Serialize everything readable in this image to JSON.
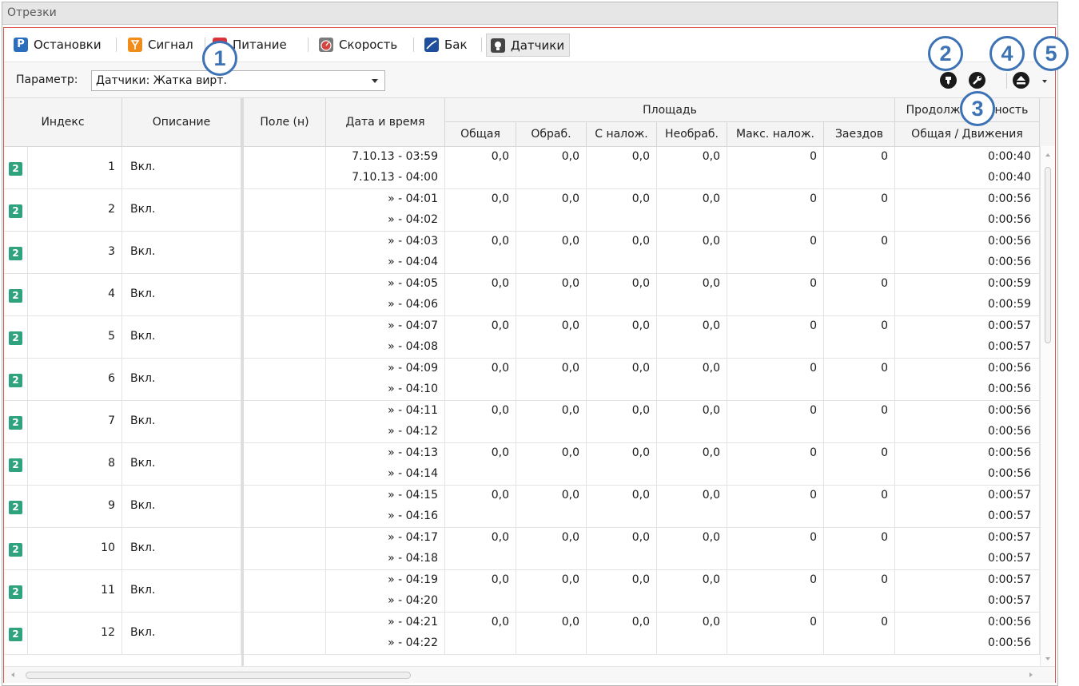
{
  "window": {
    "title": "Отрезки"
  },
  "tabs": [
    {
      "label": "Остановки",
      "icon": "parking-icon"
    },
    {
      "label": "Сигнал",
      "icon": "signal-icon"
    },
    {
      "label": "Питание",
      "icon": "power-icon"
    },
    {
      "label": "Скорость",
      "icon": "speedometer-icon"
    },
    {
      "label": "Бак",
      "icon": "fuel-tank-icon"
    },
    {
      "label": "Датчики",
      "icon": "sensor-icon",
      "active": true
    }
  ],
  "parameter": {
    "label": "Параметр:",
    "value": "Датчики: Жатка вирт."
  },
  "toolbar": {
    "icons": [
      "pin-icon",
      "wrench-icon",
      "eject-icon",
      "dropdown-arrow-icon"
    ]
  },
  "columns": {
    "index": "Индекс",
    "description": "Описание",
    "field": "Поле (н)",
    "datetime": "Дата и время",
    "area_group": "Площадь",
    "area_total": "Общая",
    "area_processed": "Обраб.",
    "area_overlap": "С налож.",
    "area_unprocessed": "Необраб.",
    "max_overlap": "Макс. налож.",
    "passes": "Заездов",
    "duration_group": "Продолжительность",
    "duration_sub": "Общая / Движения"
  },
  "rows": [
    {
      "icon": "2",
      "index": "1",
      "description": "Вкл.",
      "field": "",
      "start": "7.10.13 - 03:59",
      "end": "7.10.13 - 04:00",
      "total": "0,0",
      "processed": "0,0",
      "overlap": "0,0",
      "unprocessed": "0,0",
      "max_overlap": "0",
      "passes": "0",
      "duration_total": "0:00:40",
      "duration_moving": "0:00:40"
    },
    {
      "icon": "2",
      "index": "2",
      "description": "Вкл.",
      "field": "",
      "start": "» - 04:01",
      "end": "» - 04:02",
      "total": "0,0",
      "processed": "0,0",
      "overlap": "0,0",
      "unprocessed": "0,0",
      "max_overlap": "0",
      "passes": "0",
      "duration_total": "0:00:56",
      "duration_moving": "0:00:56"
    },
    {
      "icon": "2",
      "index": "3",
      "description": "Вкл.",
      "field": "",
      "start": "» - 04:03",
      "end": "» - 04:04",
      "total": "0,0",
      "processed": "0,0",
      "overlap": "0,0",
      "unprocessed": "0,0",
      "max_overlap": "0",
      "passes": "0",
      "duration_total": "0:00:56",
      "duration_moving": "0:00:56"
    },
    {
      "icon": "2",
      "index": "4",
      "description": "Вкл.",
      "field": "",
      "start": "» - 04:05",
      "end": "» - 04:06",
      "total": "0,0",
      "processed": "0,0",
      "overlap": "0,0",
      "unprocessed": "0,0",
      "max_overlap": "0",
      "passes": "0",
      "duration_total": "0:00:59",
      "duration_moving": "0:00:59"
    },
    {
      "icon": "2",
      "index": "5",
      "description": "Вкл.",
      "field": "",
      "start": "» - 04:07",
      "end": "» - 04:08",
      "total": "0,0",
      "processed": "0,0",
      "overlap": "0,0",
      "unprocessed": "0,0",
      "max_overlap": "0",
      "passes": "0",
      "duration_total": "0:00:57",
      "duration_moving": "0:00:57"
    },
    {
      "icon": "2",
      "index": "6",
      "description": "Вкл.",
      "field": "",
      "start": "» - 04:09",
      "end": "» - 04:10",
      "total": "0,0",
      "processed": "0,0",
      "overlap": "0,0",
      "unprocessed": "0,0",
      "max_overlap": "0",
      "passes": "0",
      "duration_total": "0:00:56",
      "duration_moving": "0:00:56"
    },
    {
      "icon": "2",
      "index": "7",
      "description": "Вкл.",
      "field": "",
      "start": "» - 04:11",
      "end": "» - 04:12",
      "total": "0,0",
      "processed": "0,0",
      "overlap": "0,0",
      "unprocessed": "0,0",
      "max_overlap": "0",
      "passes": "0",
      "duration_total": "0:00:56",
      "duration_moving": "0:00:56"
    },
    {
      "icon": "2",
      "index": "8",
      "description": "Вкл.",
      "field": "",
      "start": "» - 04:13",
      "end": "» - 04:14",
      "total": "0,0",
      "processed": "0,0",
      "overlap": "0,0",
      "unprocessed": "0,0",
      "max_overlap": "0",
      "passes": "0",
      "duration_total": "0:00:56",
      "duration_moving": "0:00:56"
    },
    {
      "icon": "2",
      "index": "9",
      "description": "Вкл.",
      "field": "",
      "start": "» - 04:15",
      "end": "» - 04:16",
      "total": "0,0",
      "processed": "0,0",
      "overlap": "0,0",
      "unprocessed": "0,0",
      "max_overlap": "0",
      "passes": "0",
      "duration_total": "0:00:57",
      "duration_moving": "0:00:57"
    },
    {
      "icon": "2",
      "index": "10",
      "description": "Вкл.",
      "field": "",
      "start": "» - 04:17",
      "end": "» - 04:18",
      "total": "0,0",
      "processed": "0,0",
      "overlap": "0,0",
      "unprocessed": "0,0",
      "max_overlap": "0",
      "passes": "0",
      "duration_total": "0:00:57",
      "duration_moving": "0:00:57"
    },
    {
      "icon": "2",
      "index": "11",
      "description": "Вкл.",
      "field": "",
      "start": "» - 04:19",
      "end": "» - 04:20",
      "total": "0,0",
      "processed": "0,0",
      "overlap": "0,0",
      "unprocessed": "0,0",
      "max_overlap": "0",
      "passes": "0",
      "duration_total": "0:00:57",
      "duration_moving": "0:00:57"
    },
    {
      "icon": "2",
      "index": "12",
      "description": "Вкл.",
      "field": "",
      "start": "» - 04:21",
      "end": "» - 04:22",
      "total": "0,0",
      "processed": "0,0",
      "overlap": "0,0",
      "unprocessed": "0,0",
      "max_overlap": "0",
      "passes": "0",
      "duration_total": "0:00:56",
      "duration_moving": "0:00:56"
    }
  ],
  "callouts": [
    "1",
    "2",
    "3",
    "4",
    "5"
  ],
  "colors": {
    "accent_border": "#d9534f",
    "callout": "#3d73b5",
    "row_icon": "#2fa37d"
  }
}
